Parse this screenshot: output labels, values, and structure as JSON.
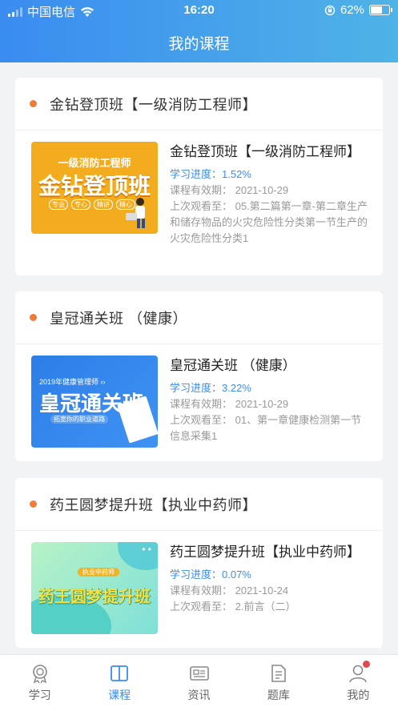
{
  "status_bar": {
    "carrier": "中国电信",
    "time": "16:20",
    "battery": "62%"
  },
  "header": {
    "title": "我的课程"
  },
  "courses": [
    {
      "group_title": "金钻登顶班【一级消防工程师】",
      "name": "金钻登顶班【一级消防工程师】",
      "progress": "学习进度：1.52%",
      "validity": "课程有效期：  2021-10-29",
      "last_watched": "上次观看至：  05.第二篇第一章-第二章生产和储存物品的火灾危险性分类第一节生产的火灾危险性分类1",
      "thumb": {
        "line1": "一级消防工程师",
        "line2": "金钻登顶班",
        "tags": [
          "专业",
          "专心",
          "精讲",
          "精心"
        ]
      }
    },
    {
      "group_title": "皇冠通关班 （健康）",
      "name": "皇冠通关班 （健康）",
      "progress": "学习进度：3.22%",
      "validity": "课程有效期：  2021-10-29",
      "last_watched": "上次观看至：  01、第一章健康检测第一节信息采集1",
      "thumb": {
        "line1": "2019年健康管理师 ››",
        "line2": "皇冠通关班",
        "line3": "拓宽你的职业道路"
      }
    },
    {
      "group_title": "药王圆梦提升班【执业中药师】",
      "name": "药王圆梦提升班【执业中药师】",
      "progress": "学习进度：0.07%",
      "validity": "课程有效期：  2021-10-24",
      "last_watched": "上次观看至：  2.前言（二）",
      "thumb": {
        "line1": "执业中药师",
        "line2": "药王圆梦提升班",
        "dots": "• •"
      }
    }
  ],
  "tabbar": {
    "items": [
      {
        "label": "学习",
        "icon": "badge-icon"
      },
      {
        "label": "课程",
        "icon": "book-icon"
      },
      {
        "label": "资讯",
        "icon": "news-icon"
      },
      {
        "label": "题库",
        "icon": "document-icon"
      },
      {
        "label": "我的",
        "icon": "user-icon"
      }
    ],
    "active": "课程"
  },
  "colors": {
    "accent": "#3a8cf0",
    "dot": "#f07c3a",
    "badge": "#e5484d"
  }
}
